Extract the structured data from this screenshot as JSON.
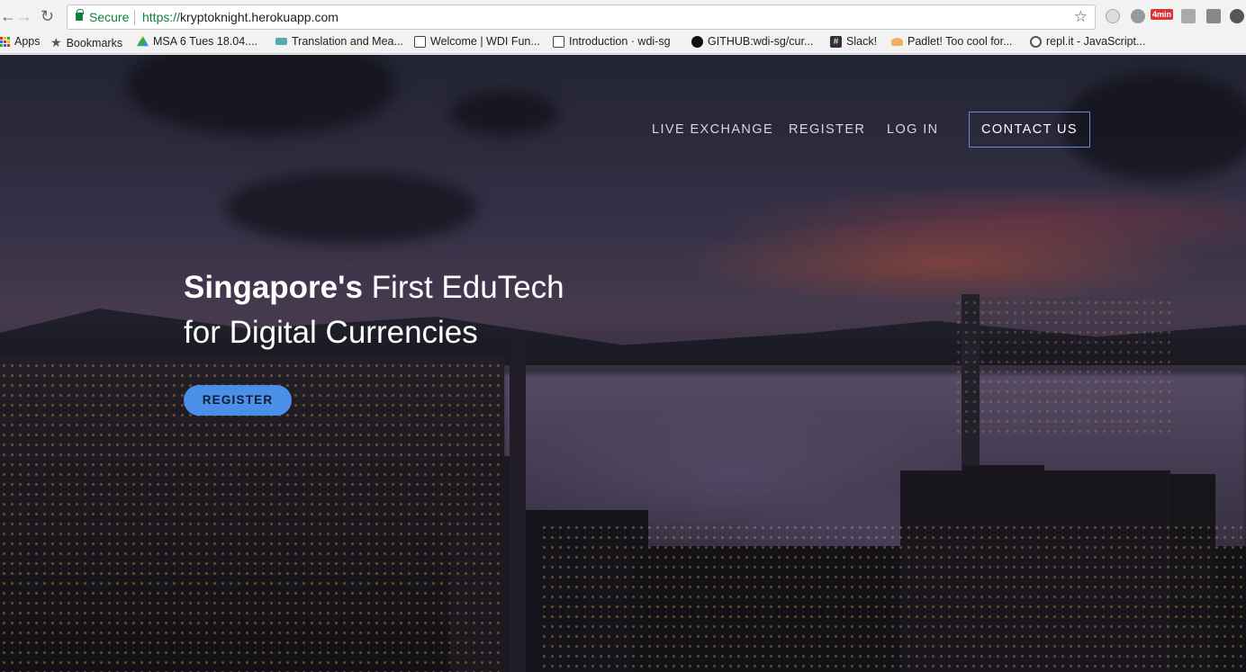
{
  "browser": {
    "secure_label": "Secure",
    "url_protocol": "https://",
    "url_domain": "kryptoknight.herokuapp.com",
    "extension_badge": "4min"
  },
  "bookmarks": [
    {
      "label": "Apps",
      "icon": "apps-grid-icon"
    },
    {
      "label": "Bookmarks",
      "icon": "star-icon"
    },
    {
      "label": "MSA 6 Tues 18.04....",
      "icon": "google-drive-icon"
    },
    {
      "label": "Translation and Mea...",
      "icon": "book-icon"
    },
    {
      "label": "Welcome | WDI Fun...",
      "icon": "book-open-icon"
    },
    {
      "label": "Introduction · wdi-sg",
      "icon": "book-open-icon"
    },
    {
      "label": "GITHUB:wdi-sg/cur...",
      "icon": "github-icon"
    },
    {
      "label": "Slack!",
      "icon": "slack-icon"
    },
    {
      "label": "Padlet! Too cool for...",
      "icon": "padlet-icon"
    },
    {
      "label": "repl.it - JavaScript...",
      "icon": "replit-icon"
    }
  ],
  "site": {
    "nav": {
      "live_exchange": "LIVE EXCHANGE",
      "register": "REGISTER",
      "login": "LOG IN",
      "contact": "CONTACT US"
    },
    "headline_bold": "Singapore's",
    "headline_rest": " First EduTech",
    "headline_line2": "for Digital Currencies",
    "register_button": "REGISTER"
  }
}
